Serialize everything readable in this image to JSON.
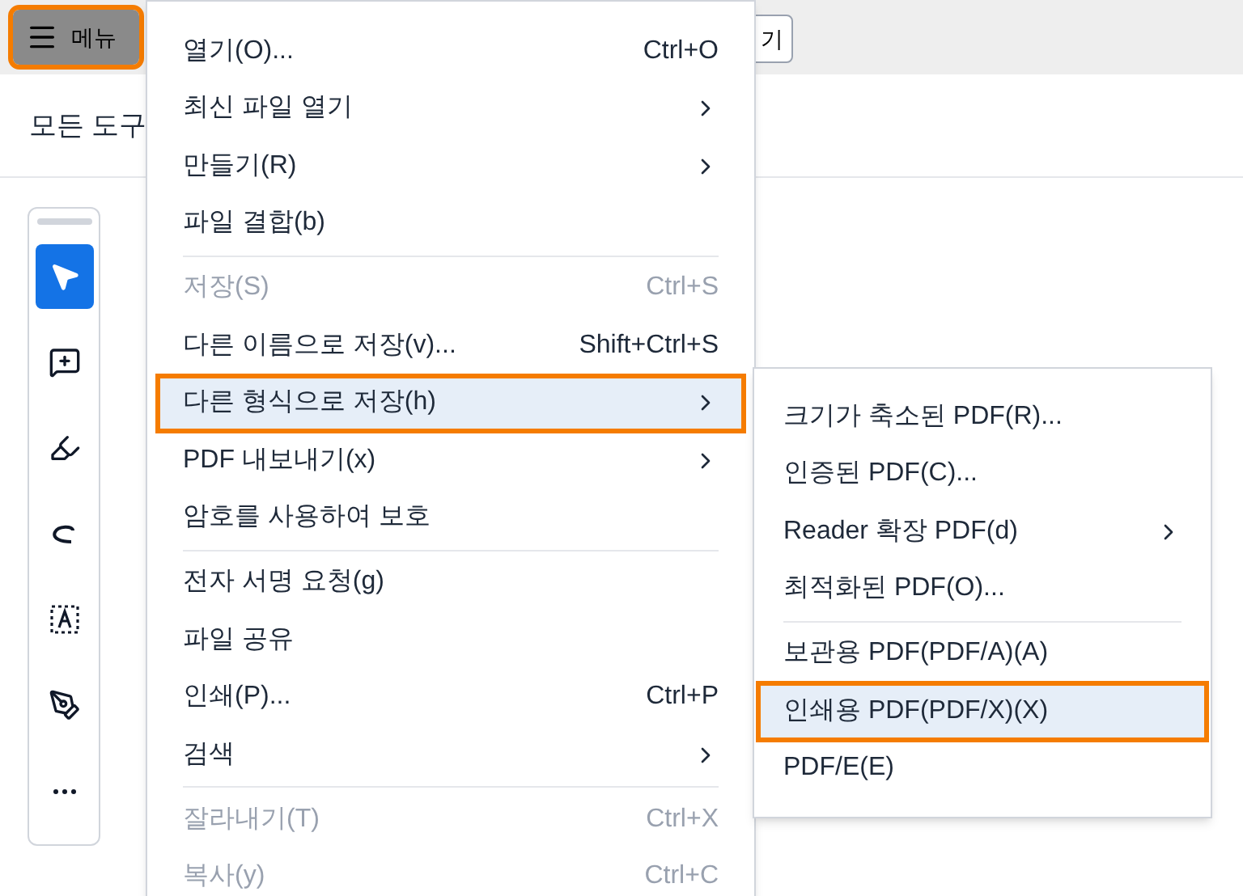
{
  "menu_button": {
    "label": "메뉴",
    "highlighted": true
  },
  "top_button": {
    "label": "기"
  },
  "tools_heading": "모든 도구",
  "toolbar": [
    {
      "kind": "pointer",
      "selected": true
    },
    {
      "kind": "comment",
      "selected": false
    },
    {
      "kind": "highlight",
      "selected": false
    },
    {
      "kind": "lasso",
      "selected": false
    },
    {
      "kind": "text",
      "selected": false
    },
    {
      "kind": "sign",
      "selected": false
    },
    {
      "kind": "more",
      "selected": false
    }
  ],
  "menu": [
    {
      "label": "열기(O)...",
      "shortcut": "Ctrl+O",
      "disabled": false,
      "submenu": false,
      "selected": false,
      "highlighted": false
    },
    {
      "label": "최신 파일 열기",
      "disabled": false,
      "submenu": true,
      "selected": false,
      "highlighted": false
    },
    {
      "label": "만들기(R)",
      "disabled": false,
      "submenu": true,
      "selected": false,
      "highlighted": false
    },
    {
      "label": "파일 결합(b)",
      "disabled": false,
      "submenu": false,
      "selected": false,
      "highlighted": false,
      "divider_after": true
    },
    {
      "label": "저장(S)",
      "shortcut": "Ctrl+S",
      "disabled": true,
      "submenu": false,
      "selected": false,
      "highlighted": false
    },
    {
      "label": "다른 이름으로 저장(v)...",
      "shortcut": "Shift+Ctrl+S",
      "disabled": false,
      "submenu": false,
      "selected": false,
      "highlighted": false
    },
    {
      "label": "다른 형식으로 저장(h)",
      "disabled": false,
      "submenu": true,
      "selected": true,
      "highlighted": true
    },
    {
      "label": "PDF 내보내기(x)",
      "disabled": false,
      "submenu": true,
      "selected": false,
      "highlighted": false
    },
    {
      "label": "암호를 사용하여 보호",
      "disabled": false,
      "submenu": false,
      "selected": false,
      "highlighted": false,
      "divider_after": true
    },
    {
      "label": "전자 서명 요청(g)",
      "disabled": false,
      "submenu": false,
      "selected": false,
      "highlighted": false
    },
    {
      "label": "파일 공유",
      "disabled": false,
      "submenu": false,
      "selected": false,
      "highlighted": false
    },
    {
      "label": "인쇄(P)...",
      "shortcut": "Ctrl+P",
      "disabled": false,
      "submenu": false,
      "selected": false,
      "highlighted": false
    },
    {
      "label": "검색",
      "disabled": false,
      "submenu": true,
      "selected": false,
      "highlighted": false,
      "divider_after": true
    },
    {
      "label": "잘라내기(T)",
      "shortcut": "Ctrl+X",
      "disabled": true,
      "submenu": false,
      "selected": false,
      "highlighted": false
    },
    {
      "label": "복사(y)",
      "shortcut": "Ctrl+C",
      "disabled": true,
      "submenu": false,
      "selected": false,
      "highlighted": false
    }
  ],
  "submenu": [
    {
      "label": "크기가 축소된 PDF(R)...",
      "submenu": false,
      "selected": false,
      "highlighted": false
    },
    {
      "label": "인증된 PDF(C)...",
      "submenu": false,
      "selected": false,
      "highlighted": false
    },
    {
      "label": "Reader 확장 PDF(d)",
      "submenu": true,
      "selected": false,
      "highlighted": false
    },
    {
      "label": "최적화된 PDF(O)...",
      "submenu": false,
      "selected": false,
      "highlighted": false,
      "divider_after": true
    },
    {
      "label": "보관용 PDF(PDF/A)(A)",
      "submenu": false,
      "selected": false,
      "highlighted": false
    },
    {
      "label": "인쇄용 PDF(PDF/X)(X)",
      "submenu": false,
      "selected": true,
      "highlighted": true
    },
    {
      "label": "PDF/E(E)",
      "submenu": false,
      "selected": false,
      "highlighted": false
    }
  ]
}
